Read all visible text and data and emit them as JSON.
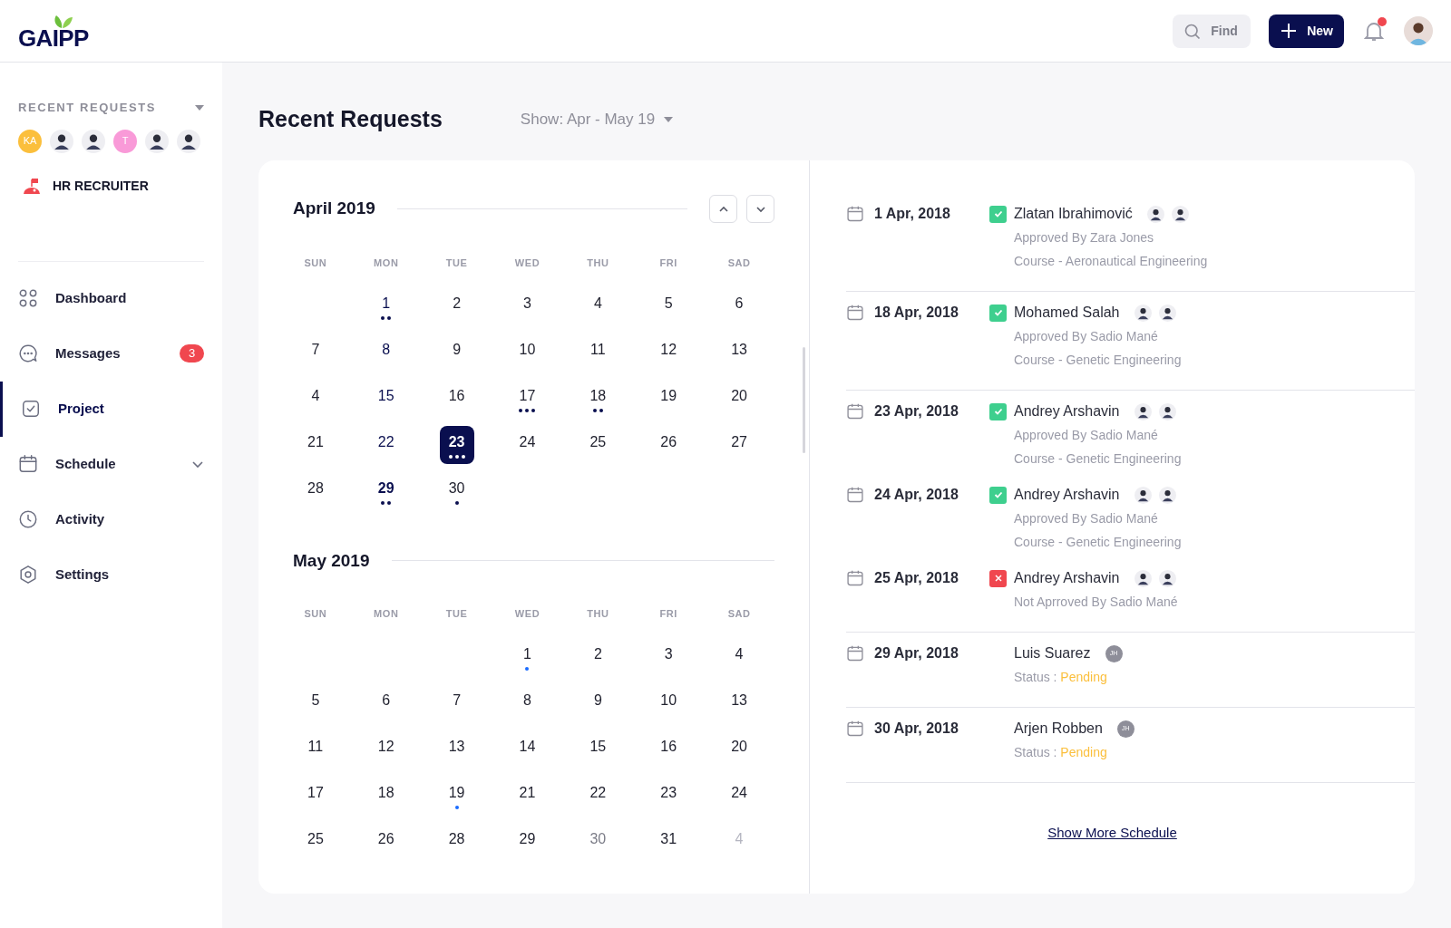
{
  "header": {
    "logo": "GAIPP",
    "search": {
      "placeholder": "Find"
    },
    "new_button": "New",
    "notifications": {
      "unread": true
    }
  },
  "sidebar": {
    "section_title": "RECENT REQUESTS",
    "avatars": [
      {
        "kind": "initials",
        "text": "KA",
        "color": "#fbbf3c"
      },
      {
        "kind": "photo"
      },
      {
        "kind": "photo"
      },
      {
        "kind": "initials",
        "text": "T",
        "color": "#f99ad8"
      },
      {
        "kind": "photo"
      },
      {
        "kind": "photo"
      }
    ],
    "role": "HR RECRUITER",
    "items": [
      {
        "label": "Dashboard",
        "selected": false,
        "has_submenu": false
      },
      {
        "label": "Messages",
        "selected": false,
        "has_submenu": false,
        "badge": "3"
      },
      {
        "label": "Project",
        "selected": true,
        "has_submenu": false
      },
      {
        "label": "Schedule",
        "selected": false,
        "has_submenu": true
      },
      {
        "label": "Activity",
        "selected": false,
        "has_submenu": false
      },
      {
        "label": "Settings",
        "selected": false,
        "has_submenu": false
      }
    ]
  },
  "page": {
    "title": "Recent Requests",
    "filter": "Show: Apr - May 19"
  },
  "calendar": {
    "months": [
      {
        "title": "April 2019",
        "navigation": true,
        "weekdays": [
          "SUN",
          "MON",
          "TUE",
          "WED",
          "THU",
          "FRI",
          "SAD"
        ],
        "weeks": [
          [
            {
              "kind": "empty"
            },
            {
              "day": "1",
              "kind": "marked",
              "selected": false,
              "dots": [
                {
                  "color": "#0a0f4f"
                },
                {
                  "color": "#0a0f4f"
                }
              ]
            },
            {
              "day": "2",
              "kind": "plain",
              "selected": false
            },
            {
              "day": "3",
              "kind": "plain",
              "selected": false
            },
            {
              "day": "4",
              "kind": "plain",
              "selected": false
            },
            {
              "day": "5",
              "kind": "plain",
              "selected": false
            },
            {
              "day": "6",
              "kind": "plain",
              "selected": false
            }
          ],
          [
            {
              "day": "7",
              "kind": "plain",
              "selected": false
            },
            {
              "day": "8",
              "kind": "marked",
              "selected": false
            },
            {
              "day": "9",
              "kind": "plain",
              "selected": false
            },
            {
              "day": "10",
              "kind": "plain",
              "selected": false
            },
            {
              "day": "11",
              "kind": "plain",
              "selected": false
            },
            {
              "day": "12",
              "kind": "plain",
              "selected": false
            },
            {
              "day": "13",
              "kind": "plain",
              "selected": false
            }
          ],
          [
            {
              "day": "4",
              "kind": "plain",
              "selected": false
            },
            {
              "day": "15",
              "kind": "marked",
              "selected": false
            },
            {
              "day": "16",
              "kind": "plain",
              "selected": false
            },
            {
              "day": "17",
              "kind": "plain",
              "selected": false,
              "dots": [
                {
                  "color": "#0a0f4f"
                },
                {
                  "color": "#0a0f4f"
                },
                {
                  "color": "#0a0f4f"
                }
              ]
            },
            {
              "day": "18",
              "kind": "plain",
              "selected": false,
              "dots": [
                {
                  "color": "#0a0f4f"
                },
                {
                  "color": "#0a0f4f"
                }
              ]
            },
            {
              "day": "19",
              "kind": "plain",
              "selected": false
            },
            {
              "day": "20",
              "kind": "plain",
              "selected": false
            }
          ],
          [
            {
              "day": "21",
              "kind": "plain",
              "selected": false
            },
            {
              "day": "22",
              "kind": "marked",
              "selected": false
            },
            {
              "day": "23",
              "kind": "plain",
              "selected": true,
              "dots": [
                {
                  "color": "#ffffff"
                },
                {
                  "color": "#ffffff"
                },
                {
                  "color": "#ffffff"
                }
              ]
            },
            {
              "day": "24",
              "kind": "plain",
              "selected": false
            },
            {
              "day": "25",
              "kind": "plain",
              "selected": false
            },
            {
              "day": "26",
              "kind": "plain",
              "selected": false
            },
            {
              "day": "27",
              "kind": "plain",
              "selected": false
            }
          ],
          [
            {
              "day": "28",
              "kind": "plain",
              "selected": false
            },
            {
              "day": "29",
              "kind": "bold",
              "selected": false,
              "dots": [
                {
                  "color": "#0a0f4f"
                },
                {
                  "color": "#0a0f4f"
                }
              ]
            },
            {
              "day": "30",
              "kind": "plain",
              "selected": false,
              "dots": [
                {
                  "color": "#0a0f4f"
                }
              ]
            }
          ]
        ]
      },
      {
        "title": "May 2019",
        "navigation": false,
        "weekdays": [
          "SUN",
          "MON",
          "TUE",
          "WED",
          "THU",
          "FRI",
          "SAD"
        ],
        "weeks": [
          [
            {
              "kind": "empty"
            },
            {
              "kind": "empty"
            },
            {
              "kind": "empty"
            },
            {
              "day": "1",
              "kind": "plain",
              "selected": false,
              "dots": [
                {
                  "color": "#1a6cff"
                }
              ]
            },
            {
              "day": "2",
              "kind": "plain",
              "selected": false
            },
            {
              "day": "3",
              "kind": "plain",
              "selected": false
            },
            {
              "day": "4",
              "kind": "plain",
              "selected": false
            }
          ],
          [
            {
              "day": "5",
              "kind": "plain",
              "selected": false
            },
            {
              "day": "6",
              "kind": "plain",
              "selected": false
            },
            {
              "day": "7",
              "kind": "plain",
              "selected": false
            },
            {
              "day": "8",
              "kind": "plain",
              "selected": false
            },
            {
              "day": "9",
              "kind": "plain",
              "selected": false
            },
            {
              "day": "10",
              "kind": "plain",
              "selected": false
            },
            {
              "day": "13",
              "kind": "plain",
              "selected": false
            }
          ],
          [
            {
              "day": "11",
              "kind": "plain",
              "selected": false
            },
            {
              "day": "12",
              "kind": "plain",
              "selected": false
            },
            {
              "day": "13",
              "kind": "plain",
              "selected": false
            },
            {
              "day": "14",
              "kind": "plain",
              "selected": false
            },
            {
              "day": "15",
              "kind": "plain",
              "selected": false
            },
            {
              "day": "16",
              "kind": "plain",
              "selected": false
            },
            {
              "day": "20",
              "kind": "plain",
              "selected": false
            }
          ],
          [
            {
              "day": "17",
              "kind": "plain",
              "selected": false
            },
            {
              "day": "18",
              "kind": "plain",
              "selected": false
            },
            {
              "day": "19",
              "kind": "plain",
              "selected": false,
              "dots": [
                {
                  "color": "#1a6cff"
                }
              ]
            },
            {
              "day": "21",
              "kind": "plain",
              "selected": false
            },
            {
              "day": "22",
              "kind": "plain",
              "selected": false
            },
            {
              "day": "23",
              "kind": "plain",
              "selected": false
            },
            {
              "day": "24",
              "kind": "plain",
              "selected": false
            }
          ],
          [
            {
              "day": "25",
              "kind": "plain",
              "selected": false
            },
            {
              "day": "26",
              "kind": "plain",
              "selected": false
            },
            {
              "day": "28",
              "kind": "plain",
              "selected": false
            },
            {
              "day": "29",
              "kind": "plain",
              "selected": false
            },
            {
              "day": "30",
              "kind": "dim",
              "selected": false
            },
            {
              "day": "31",
              "kind": "plain",
              "selected": false
            },
            {
              "day": "4",
              "kind": "outside",
              "selected": false
            }
          ]
        ]
      }
    ]
  },
  "requests": {
    "groups": [
      [
        {
          "date": "1 Apr, 2018",
          "kind": "approved",
          "name": "Zlatan Ibrahimović",
          "avatars": [
            {
              "kind": "photo"
            },
            {
              "kind": "photo"
            }
          ],
          "details": [
            "Approved By Zara Jones",
            "Course - Aeronautical Engineering"
          ]
        }
      ],
      [
        {
          "date": "18 Apr, 2018",
          "kind": "approved",
          "name": "Mohamed Salah",
          "avatars": [
            {
              "kind": "photo"
            },
            {
              "kind": "photo"
            }
          ],
          "details": [
            "Approved By Sadio Mané",
            "Course - Genetic Engineering"
          ]
        }
      ],
      [
        {
          "date": "23 Apr, 2018",
          "kind": "approved",
          "name": "Andrey Arshavin",
          "avatars": [
            {
              "kind": "photo"
            },
            {
              "kind": "photo"
            }
          ],
          "details": [
            "Approved By Sadio Mané",
            "Course - Genetic Engineering"
          ]
        },
        {
          "date": "24 Apr, 2018",
          "kind": "approved",
          "name": "Andrey Arshavin",
          "avatars": [
            {
              "kind": "photo"
            },
            {
              "kind": "photo"
            }
          ],
          "details": [
            "Approved By Sadio Mané",
            "Course - Genetic Engineering"
          ]
        },
        {
          "date": "25 Apr, 2018",
          "kind": "rejected",
          "name": "Andrey Arshavin",
          "avatars": [
            {
              "kind": "photo"
            },
            {
              "kind": "photo"
            }
          ],
          "details": [
            "Not Aprroved By Sadio Mané"
          ]
        }
      ],
      [
        {
          "date": "29 Apr, 2018",
          "kind": "pending",
          "name": "Luis Suarez",
          "avatars": [
            {
              "kind": "initials",
              "text": "JH"
            }
          ],
          "status_label": "Status :",
          "status_value": "Pending"
        }
      ],
      [
        {
          "date": "30 Apr, 2018",
          "kind": "pending",
          "name": "Arjen Robben",
          "avatars": [
            {
              "kind": "initials",
              "text": "JH"
            }
          ],
          "status_label": "Status :",
          "status_value": "Pending"
        }
      ]
    ],
    "more_link": "Show More Schedule"
  }
}
